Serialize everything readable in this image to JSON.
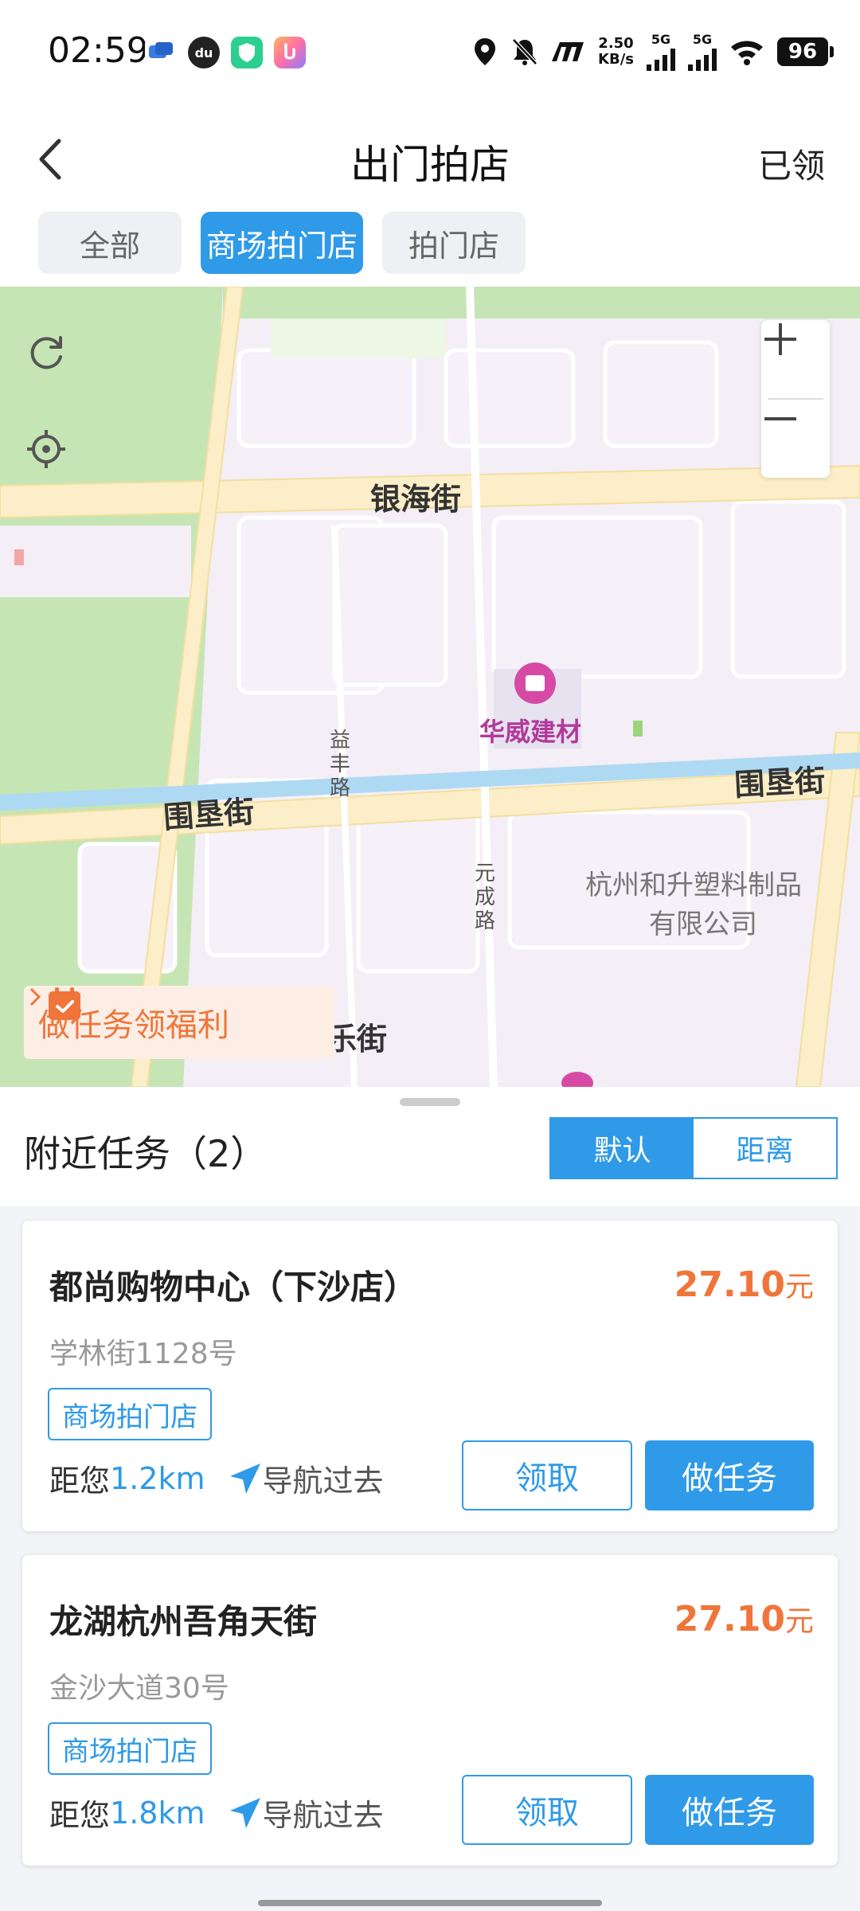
{
  "status_bar": {
    "time": "02:59",
    "net_speed_value": "2.50",
    "net_speed_unit": "KB/s",
    "sim1": "5G",
    "sim2": "5G",
    "battery": "96"
  },
  "header": {
    "title": "出门拍店",
    "claimed_label": "已领"
  },
  "tabs": [
    {
      "label": "全部",
      "active": false
    },
    {
      "label": "商场拍门店",
      "active": true
    },
    {
      "label": "拍门店",
      "active": false
    }
  ],
  "map": {
    "roads": {
      "yinhai": "银海街",
      "weiken_left": "围垦街",
      "weiken_right": "围垦街",
      "yifeng": "益丰路",
      "yuancheng": "元成路",
      "bottom_partial": "乐街"
    },
    "pois": {
      "huawei": "华威建材",
      "hesheng_line1": "杭州和升塑料制品",
      "hesheng_line2": "有限公司"
    },
    "promo_text": "做任务领福利"
  },
  "nearby": {
    "title": "附近任务（2）",
    "sort_options": [
      {
        "label": "默认",
        "active": true
      },
      {
        "label": "距离",
        "active": false
      }
    ]
  },
  "tasks": [
    {
      "name": "都尚购物中心（下沙店）",
      "price": "27.10",
      "unit": "元",
      "address": "学林街1128号",
      "tag": "商场拍门店",
      "distance_prefix": "距您",
      "distance": "1.2km",
      "navigate": "导航过去",
      "claim": "领取",
      "do_task": "做任务"
    },
    {
      "name": "龙湖杭州吾角天街",
      "price": "27.10",
      "unit": "元",
      "address": "金沙大道30号",
      "tag": "商场拍门店",
      "distance_prefix": "距您",
      "distance": "1.8km",
      "navigate": "导航过去",
      "claim": "领取",
      "do_task": "做任务"
    }
  ],
  "colors": {
    "accent": "#2f9ae8",
    "price": "#f0753a",
    "promo_bg": "#fdeee5"
  }
}
